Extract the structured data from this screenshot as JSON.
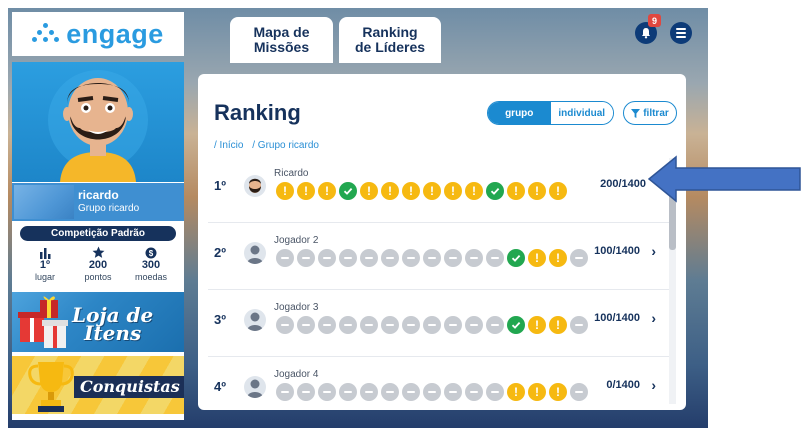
{
  "header": {
    "logo_text": "engage",
    "tabs": [
      {
        "label_line1": "Mapa de",
        "label_line2": "Missões"
      },
      {
        "label_line1": "Ranking",
        "label_line2": "de Líderes"
      }
    ],
    "notifications_count": "9"
  },
  "sidebar": {
    "user_name": "ricardo",
    "user_group": "Grupo ricardo",
    "competition": "Competição Padrão",
    "stats": [
      {
        "value": "1º",
        "label": "lugar"
      },
      {
        "value": "200",
        "label": "pontos"
      },
      {
        "value": "300",
        "label": "moedas"
      }
    ],
    "banners": [
      {
        "title_line1": "Loja de",
        "title_line2": "Itens"
      },
      {
        "title": "Conquistas"
      }
    ]
  },
  "ranking": {
    "title": "Ranking",
    "toggle": {
      "active": "grupo",
      "inactive": "individual"
    },
    "filter_label": "filtrar",
    "breadcrumb": [
      "/ Início",
      "/ Grupo ricardo"
    ],
    "rows": [
      {
        "position": "1º",
        "name": "Ricardo",
        "score": "200/1400",
        "marks": "yyycyyyyyycyyy",
        "show_chevron": false
      },
      {
        "position": "2º",
        "name": "Jogador 2",
        "score": "100/1400",
        "marks": "gggggggggggcyyg",
        "show_chevron": true
      },
      {
        "position": "3º",
        "name": "Jogador 3",
        "score": "100/1400",
        "marks": "gggggggggggcyyg",
        "show_chevron": true
      },
      {
        "position": "4º",
        "name": "Jogador 4",
        "score": "0/1400",
        "marks": "gggggggggggyyyg",
        "show_chevron": true
      }
    ]
  },
  "colors": {
    "navy": "#16325c",
    "accent_blue": "#1b8ad0",
    "warning_yellow": "#f6b911",
    "done_green": "#22a750",
    "pending_gray": "#c7cbd1",
    "annotation_arrow": "#4472c4"
  }
}
